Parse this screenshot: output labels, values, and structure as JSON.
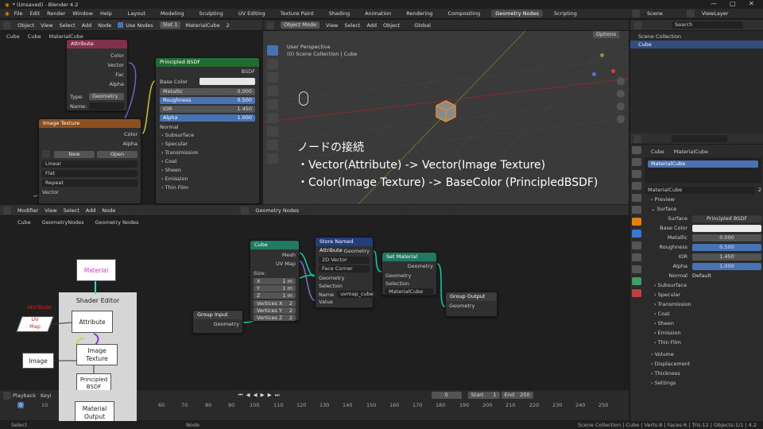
{
  "titlebar": {
    "title": "* (Unsaved) - Blender 4.2",
    "controls": [
      "—",
      "□",
      "✕"
    ]
  },
  "menu": [
    "File",
    "Edit",
    "Render",
    "Window",
    "Help"
  ],
  "workspaces": [
    "Layout",
    "Modeling",
    "Sculpting",
    "UV Editing",
    "Texture Paint",
    "Shading",
    "Animation",
    "Rendering",
    "Compositing",
    "Geometry Nodes",
    "Scripting"
  ],
  "active_workspace": "Geometry Nodes",
  "scene": "Scene",
  "view_layer": "ViewLayer",
  "shader_header": {
    "object": "Object",
    "view": "View",
    "select": "Select",
    "add": "Add",
    "node": "Node",
    "use_nodes": "Use Nodes",
    "slot": "Slot 1",
    "material": "MaterialCube",
    "users": "2",
    "breadcrumb": [
      "Cube",
      "Cube",
      "MaterialCube"
    ]
  },
  "attr_node": {
    "title": "Attribute",
    "outs": [
      "Color",
      "Vector",
      "Fac",
      "Alpha"
    ],
    "type_label": "Type:",
    "type_value": "Geometry",
    "name_label": "Name:"
  },
  "img_node": {
    "title": "Image Texture",
    "outs": [
      "Color",
      "Alpha"
    ],
    "new": "New",
    "open": "Open",
    "interp": "Linear",
    "proj": "Flat",
    "ext": "Repeat",
    "in": "Vector"
  },
  "bsdf_node": {
    "title": "Principled BSDF",
    "out": "BSDF",
    "base": "Base Color",
    "rows": [
      {
        "l": "Metallic",
        "v": "0.000"
      },
      {
        "l": "Roughness",
        "v": "0.500"
      },
      {
        "l": "IOR",
        "v": "1.450"
      },
      {
        "l": "Alpha",
        "v": "1.000"
      }
    ],
    "normal": "Normal",
    "subs": [
      "Subsurface",
      "Specular",
      "Transmission",
      "Coat",
      "Sheen",
      "Emission",
      "Thin Film"
    ]
  },
  "viewport": {
    "mode": "Object Mode",
    "menus": [
      "View",
      "Select",
      "Add",
      "Object"
    ],
    "transform": "Global",
    "options": "Options",
    "persp": "User Perspective",
    "coll": "(0) Scene Collection | Cube"
  },
  "overlay_text": [
    "ノードの接続",
    "・Vector(Attribute) ->  Vector(Image Texture)",
    "・Color(Image Texture)  -> BaseColor (PrincipledBSDF)"
  ],
  "outliner": {
    "search": "Search",
    "root": "Scene Collection",
    "item": "Cube"
  },
  "props": {
    "breadcrumb": [
      "Cube",
      "MaterialCube"
    ],
    "slot": "MaterialCube",
    "mat": "MaterialCube",
    "users": "2",
    "preview": "Preview",
    "surface": "Surface",
    "surface_lbl": "Surface",
    "surface_val": "Principled BSDF",
    "base_color": "Base Color",
    "rows": [
      {
        "l": "Metallic",
        "v": "0.000",
        "blue": false
      },
      {
        "l": "Roughness",
        "v": "0.500",
        "blue": true
      },
      {
        "l": "IOR",
        "v": "1.450",
        "blue": false
      },
      {
        "l": "Alpha",
        "v": "1.000",
        "blue": true
      }
    ],
    "normal_lbl": "Normal",
    "normal_val": "Default",
    "subs": [
      "Subsurface",
      "Specular",
      "Transmission",
      "Coat",
      "Sheen",
      "Emission",
      "Thin Film"
    ],
    "bottom": [
      "Volume",
      "Displacement",
      "Thickness",
      "Settings"
    ]
  },
  "gn_header": {
    "editor": "Modifier",
    "menus": [
      "View",
      "Select",
      "Add",
      "Node"
    ],
    "tree": "Geometry Nodes",
    "breadcrumb": [
      "Cube",
      "GeometryNodes",
      "Geometry Nodes"
    ]
  },
  "gn_cube": {
    "title": "Cube",
    "outs": [
      "Mesh",
      "UV Map"
    ],
    "size": "Size:",
    "xyz": [
      {
        "l": "X",
        "v": "1 m"
      },
      {
        "l": "Y",
        "v": "1 m"
      },
      {
        "l": "Z",
        "v": "1 m"
      }
    ],
    "verts": [
      {
        "l": "Vertices X",
        "v": "2"
      },
      {
        "l": "Vertices Y",
        "v": "2"
      },
      {
        "l": "Vertices Z",
        "v": "2"
      }
    ]
  },
  "gn_store": {
    "title": "Store Named Attribute",
    "out": "Geometry",
    "type": "2D Vector",
    "domain": "Face Corner",
    "ins": [
      "Geometry",
      "Selection"
    ],
    "name_lbl": "Name",
    "name_val": "uvmap_cube",
    "value": "Value"
  },
  "gn_setmat": {
    "title": "Set Material",
    "out": "Geometry",
    "ins": [
      "Geometry",
      "Selection"
    ],
    "mat": "MaterialCube"
  },
  "gn_in": {
    "title": "Group Input",
    "out": "Geometry"
  },
  "gn_out": {
    "title": "Group Output",
    "in": "Geometry"
  },
  "diagram": {
    "material": "Material",
    "shader_editor": "Shader Editor",
    "attribute_red": "Attribute",
    "uv_map": "UV\nMap",
    "attribute_box": "Attribute",
    "image": "Image",
    "image_texture": "Image\nTexture",
    "principled": "Principled\nBSDF",
    "mat_output": "Material\nOutput"
  },
  "timeline": {
    "playback": "Playback",
    "keying": "Keyi",
    "frame": "0",
    "start_lbl": "Start",
    "start": "1",
    "end_lbl": "End",
    "end": "250",
    "ticks": [
      "0",
      "10",
      "60",
      "70",
      "80",
      "90",
      "100",
      "110",
      "120",
      "130",
      "140",
      "150",
      "160",
      "170",
      "180",
      "190",
      "200",
      "210",
      "220",
      "230",
      "240",
      "250"
    ]
  },
  "status": {
    "left": "Select",
    "mid": "Node",
    "right": "Scene Collection | Cube | Verts:8 | Faces:6 | Tris:12 | Objects:1/1 | 4.2"
  }
}
